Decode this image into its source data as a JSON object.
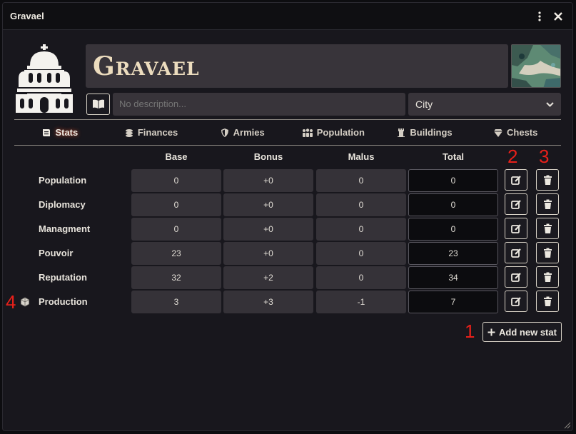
{
  "window": {
    "title": "Gravael",
    "menu_icon": "vertical-ellipsis-icon",
    "close_icon": "close-icon"
  },
  "header": {
    "name": "Gravael",
    "emblem_icon": "cathedral-icon",
    "map_thumbnail_icon": "map-thumbnail",
    "book_icon": "book-icon",
    "description_placeholder": "No description...",
    "type_value": "City"
  },
  "tabs": [
    {
      "label": "Stats",
      "icon": "scroll-icon",
      "active": true
    },
    {
      "label": "Finances",
      "icon": "coins-icon",
      "active": false
    },
    {
      "label": "Armies",
      "icon": "shield-icon",
      "active": false
    },
    {
      "label": "Population",
      "icon": "people-icon",
      "active": false
    },
    {
      "label": "Buildings",
      "icon": "tower-icon",
      "active": false
    },
    {
      "label": "Chests",
      "icon": "gem-icon",
      "active": false
    }
  ],
  "stats": {
    "columns": [
      "Base",
      "Bonus",
      "Malus",
      "Total"
    ],
    "rows": [
      {
        "name": "Population",
        "base": "0",
        "bonus": "+0",
        "malus": "0",
        "total": "0"
      },
      {
        "name": "Diplomacy",
        "base": "0",
        "bonus": "+0",
        "malus": "0",
        "total": "0"
      },
      {
        "name": "Managment",
        "base": "0",
        "bonus": "+0",
        "malus": "0",
        "total": "0"
      },
      {
        "name": "Pouvoir",
        "base": "23",
        "bonus": "+0",
        "malus": "0",
        "total": "23"
      },
      {
        "name": "Reputation",
        "base": "32",
        "bonus": "+2",
        "malus": "0",
        "total": "34"
      },
      {
        "name": "Production",
        "base": "3",
        "bonus": "+3",
        "malus": "-1",
        "total": "7",
        "dice_icon": "dice-icon"
      }
    ],
    "add_button_label": "Add new stat"
  },
  "annotations": [
    "1",
    "2",
    "3",
    "4"
  ],
  "colors": {
    "background": "#18171d",
    "field": "#38343a",
    "title_text": "#ecdcbe",
    "annotation": "#e8201a"
  }
}
